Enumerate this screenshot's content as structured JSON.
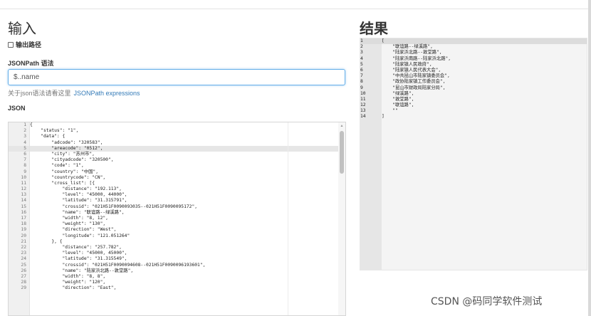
{
  "input_panel": {
    "title": "输入",
    "output_path_label": "输出路径",
    "output_path_checked": false,
    "syntax_label": "JSONPath 语法",
    "query_value": "$..name",
    "help_text": "关于json语法请看这里",
    "help_link": "JSONPath expressions",
    "json_label": "JSON"
  },
  "json_editor": {
    "active_line": 5,
    "lines": [
      "{",
      "    \"status\": \"1\",",
      "    \"data\": {",
      "        \"adcode\": \"320583\",",
      "        \"areacode\": \"0512\",",
      "        \"city\": \"苏州市\",",
      "        \"cityadcode\": \"320500\",",
      "        \"code\": \"1\",",
      "        \"country\": \"中国\",",
      "        \"countrycode\": \"CN\",",
      "        \"cross_list\": [{",
      "            \"distance\": \"192.113\",",
      "            \"level\": \"45000, 44000\",",
      "            \"latitude\": \"31.315791\",",
      "            \"crossid\": \"021H51F0090093035--021H51F0090095172\",",
      "            \"name\": \"联谊路--绿溪路\",",
      "            \"width\": \"8, 12\",",
      "            \"weight\": \"130\",",
      "            \"direction\": \"West\",",
      "            \"longitude\": \"121.051264\"",
      "        }, {",
      "            \"distance\": \"257.782\",",
      "            \"level\": \"45000, 45000\",",
      "            \"latitude\": \"31.315549\",",
      "            \"crossid\": \"021H51F0090094608--021H51F0090096193601\",",
      "            \"name\": \"陆家浜北路--敦堂路\",",
      "            \"width\": \"8, 8\",",
      "            \"weight\": \"120\",",
      "            \"direction\": \"East\","
    ]
  },
  "result_panel": {
    "title": "结果",
    "active_line": 1,
    "lines": [
      "[",
      "    \"联谊路--绿溪路\",",
      "    \"陆家浜北路--敦堂路\",",
      "    \"陆家浜南路--陆家浜北路\",",
      "    \"陆家镇人民政府\",",
      "    \"陆家镇人民代表大会\",",
      "    \"中共昆山市陆家镇委员会\",",
      "    \"政协陆家镇工作委员会\",",
      "    \"昆山市财政局陆家分局\",",
      "    \"绿溪路\",",
      "    \"敦堂路\",",
      "    \"联谊路\",",
      "    \"\"",
      "]"
    ]
  },
  "watermark": "CSDN @码同学软件测试"
}
